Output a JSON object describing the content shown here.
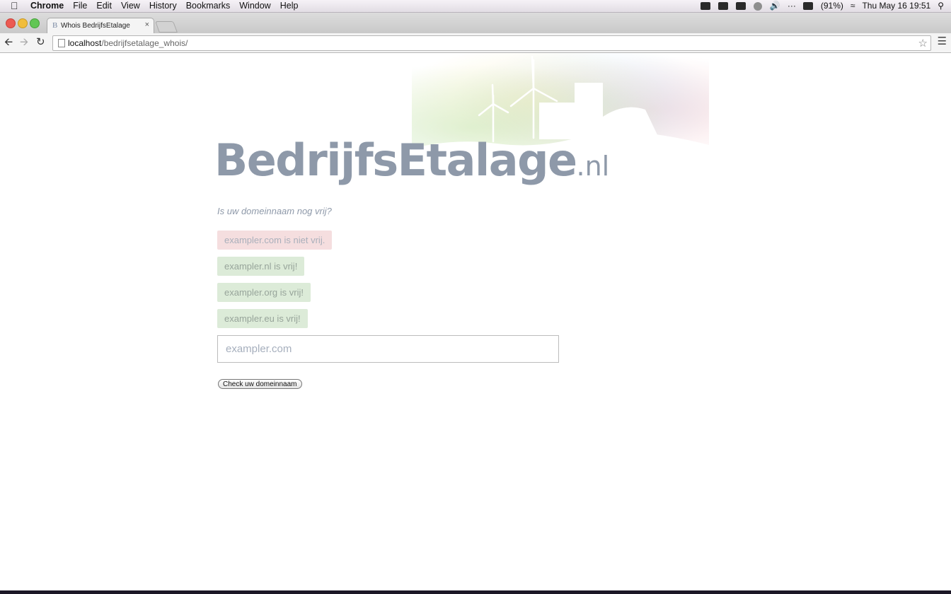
{
  "menubar": {
    "app_name": "Chrome",
    "menus": [
      "File",
      "Edit",
      "View",
      "History",
      "Bookmarks",
      "Window",
      "Help"
    ],
    "battery": "(91%)",
    "clock": "Thu May 16  19:51"
  },
  "browser": {
    "tab_title": "Whois BedrijfsEtalage",
    "tab_favicon": "B",
    "url_host": "localhost",
    "url_path": "/bedrijfsetalage_whois/"
  },
  "page": {
    "logo_main": "BedrijfsEtalage",
    "logo_tld": ".nl",
    "tagline": "Is uw domeinnaam nog vrij?",
    "results": [
      {
        "text": "exampler.com is niet vrij.",
        "status": "taken"
      },
      {
        "text": "exampler.nl is vrij!",
        "status": "free"
      },
      {
        "text": "exampler.org is vrij!",
        "status": "free"
      },
      {
        "text": "exampler.eu is vrij!",
        "status": "free"
      }
    ],
    "domain_placeholder": "exampler.com",
    "check_button": "Check uw domeinnaam"
  },
  "colors": {
    "taken_bg": "#f5dedf",
    "free_bg": "#dcebd8",
    "logo": "#8e99a9"
  }
}
